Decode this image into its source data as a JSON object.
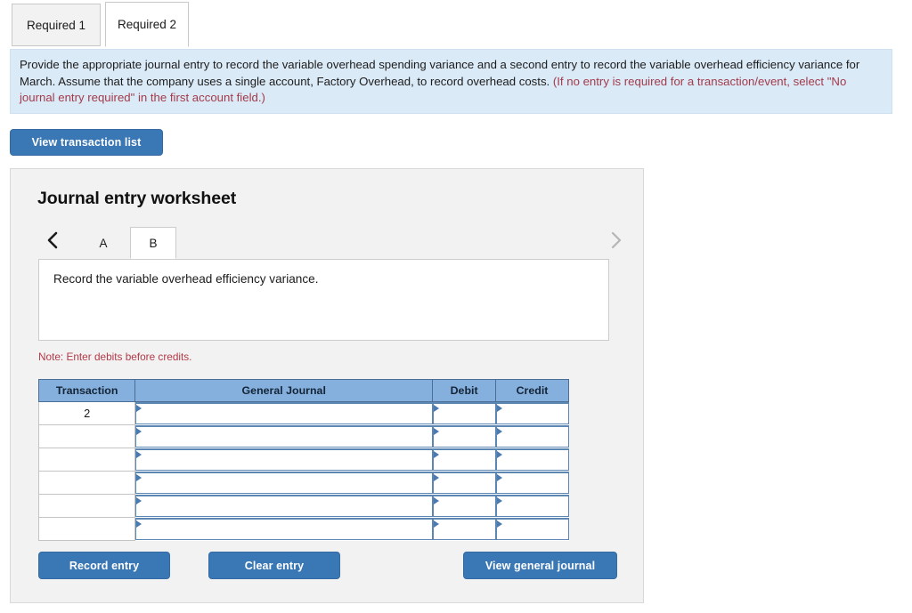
{
  "required_tabs": [
    {
      "label": "Required 1",
      "active": false
    },
    {
      "label": "Required 2",
      "active": true
    }
  ],
  "instruction": {
    "text_main": "Provide the appropriate journal entry to record the variable overhead spending variance and a second entry to record the variable overhead efficiency variance for March. Assume that the company uses a single account, Factory Overhead, to record overhead costs. ",
    "text_note": "(If no entry is required for a transaction/event, select \"No journal entry required\" in the first account field.)"
  },
  "buttons": {
    "view_transaction_list": "View transaction list",
    "record_entry": "Record entry",
    "clear_entry": "Clear entry",
    "view_general_journal": "View general journal"
  },
  "worksheet": {
    "title": "Journal entry worksheet",
    "pager": {
      "prev_icon": "chevron-left-icon",
      "next_icon": "chevron-right-icon",
      "prev_enabled": true,
      "next_enabled": false,
      "tabs": [
        {
          "label": "A",
          "active": false
        },
        {
          "label": "B",
          "active": true
        }
      ]
    },
    "description": "Record the variable overhead efficiency variance.",
    "note": "Note: Enter debits before credits.",
    "table": {
      "headers": [
        "Transaction",
        "General Journal",
        "Debit",
        "Credit"
      ],
      "rows": [
        {
          "transaction": "2",
          "general_journal": "",
          "debit": "",
          "credit": ""
        },
        {
          "transaction": "",
          "general_journal": "",
          "debit": "",
          "credit": ""
        },
        {
          "transaction": "",
          "general_journal": "",
          "debit": "",
          "credit": ""
        },
        {
          "transaction": "",
          "general_journal": "",
          "debit": "",
          "credit": ""
        },
        {
          "transaction": "",
          "general_journal": "",
          "debit": "",
          "credit": ""
        },
        {
          "transaction": "",
          "general_journal": "",
          "debit": "",
          "credit": ""
        }
      ]
    }
  },
  "colors": {
    "button_blue": "#3a77b5",
    "table_header_blue": "#85b0dd",
    "instruction_bg": "#dbeaf7",
    "note_red": "#b23a48",
    "panel_bg": "#f2f2f2",
    "cell_border_blue": "#5d87b3"
  }
}
